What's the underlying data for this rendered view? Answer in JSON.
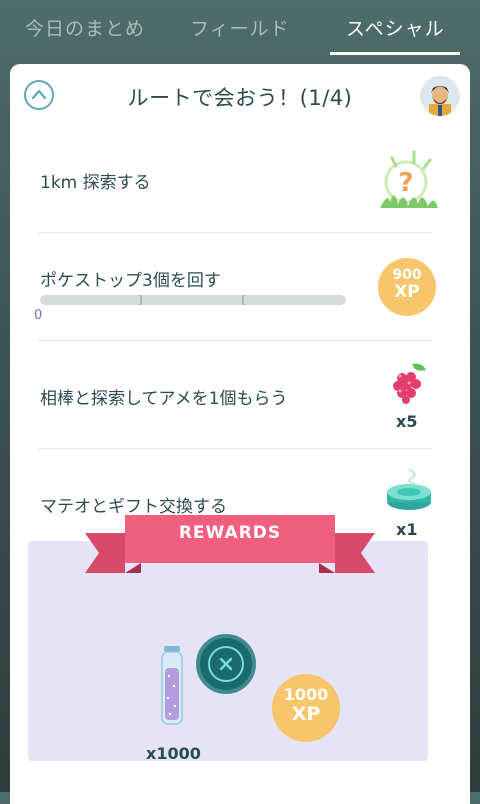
{
  "tabs": [
    {
      "label": "今日のまとめ"
    },
    {
      "label": "フィールド"
    },
    {
      "label": "スペシャル"
    }
  ],
  "card": {
    "title": "ルートで会おう！(1/4)"
  },
  "tasks": [
    {
      "label": "1km 探索する",
      "reward_icon": "mystery-encounter-icon"
    },
    {
      "label": "ポケストップ3個を回す",
      "progress_value": "0",
      "reward": {
        "xp_amount": "900",
        "xp_unit": "XP"
      }
    },
    {
      "label": "相棒と探索してアメを1個もらう",
      "reward_icon": "razz-berry-icon",
      "quantity": "x5"
    },
    {
      "label": "マテオとギフト交換する",
      "reward_icon": "incense-icon",
      "quantity": "x1"
    }
  ],
  "rewards": {
    "banner": "REWARDS",
    "items": [
      {
        "icon": "stardust-vial-icon",
        "quantity": "x1000"
      },
      {
        "xp_amount": "1000",
        "xp_unit": "XP"
      }
    ]
  },
  "colors": {
    "accent": "#5fa7b5",
    "xp_badge": "#f7c56a",
    "ribbon": "#f0607e",
    "text": "#2b4b52",
    "rewards_bg": "#e6e3f6"
  }
}
